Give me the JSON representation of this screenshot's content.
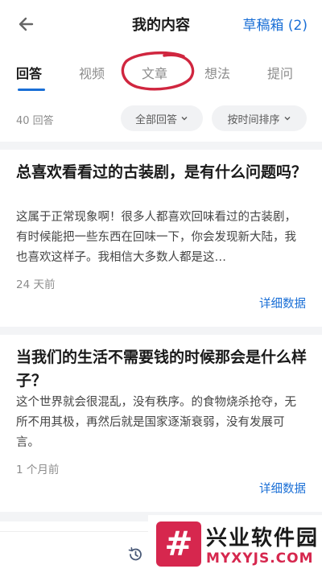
{
  "header": {
    "title": "我的内容",
    "drafts_label": "草稿箱 (2)"
  },
  "tabs": [
    {
      "label": "回答",
      "active": true
    },
    {
      "label": "视频",
      "active": false
    },
    {
      "label": "文章",
      "active": false
    },
    {
      "label": "想法",
      "active": false
    },
    {
      "label": "提问",
      "active": false
    }
  ],
  "filter": {
    "count_label": "40 回答",
    "scope_label": "全部回答",
    "sort_label": "按时间排序"
  },
  "answers": [
    {
      "title": "总喜欢看看过的古装剧，是有什么问题吗？",
      "excerpt": "这属于正常现象啊！很多人都喜欢回味看过的古装剧，有时候能把一些东西在回味一下，你会发现新大陆，我也喜欢这样子。我相信大多数人都是这…",
      "time": "24 天前",
      "detail_label": "详细数据"
    },
    {
      "title": "当我们的生活不需要钱的时候那会是什么样子？",
      "excerpt": "这个世界就会很混乱，没有秩序。的食物烧杀抢夺，无所不用其极，再然后就是国家逐渐衰弱，没有发展可言。",
      "time": "1 个月前",
      "detail_label": "详细数据"
    }
  ],
  "watermark": {
    "logo_glyph": "#",
    "name": "兴业软件园",
    "domain": "MYXYJS.COM"
  },
  "colors": {
    "accent": "#1a6fd6",
    "annotation_circle": "#d0263f",
    "watermark": "#d6274e"
  },
  "icons": {
    "back": "back-arrow-icon",
    "chevron": "chevron-down-icon",
    "history": "history-icon"
  }
}
